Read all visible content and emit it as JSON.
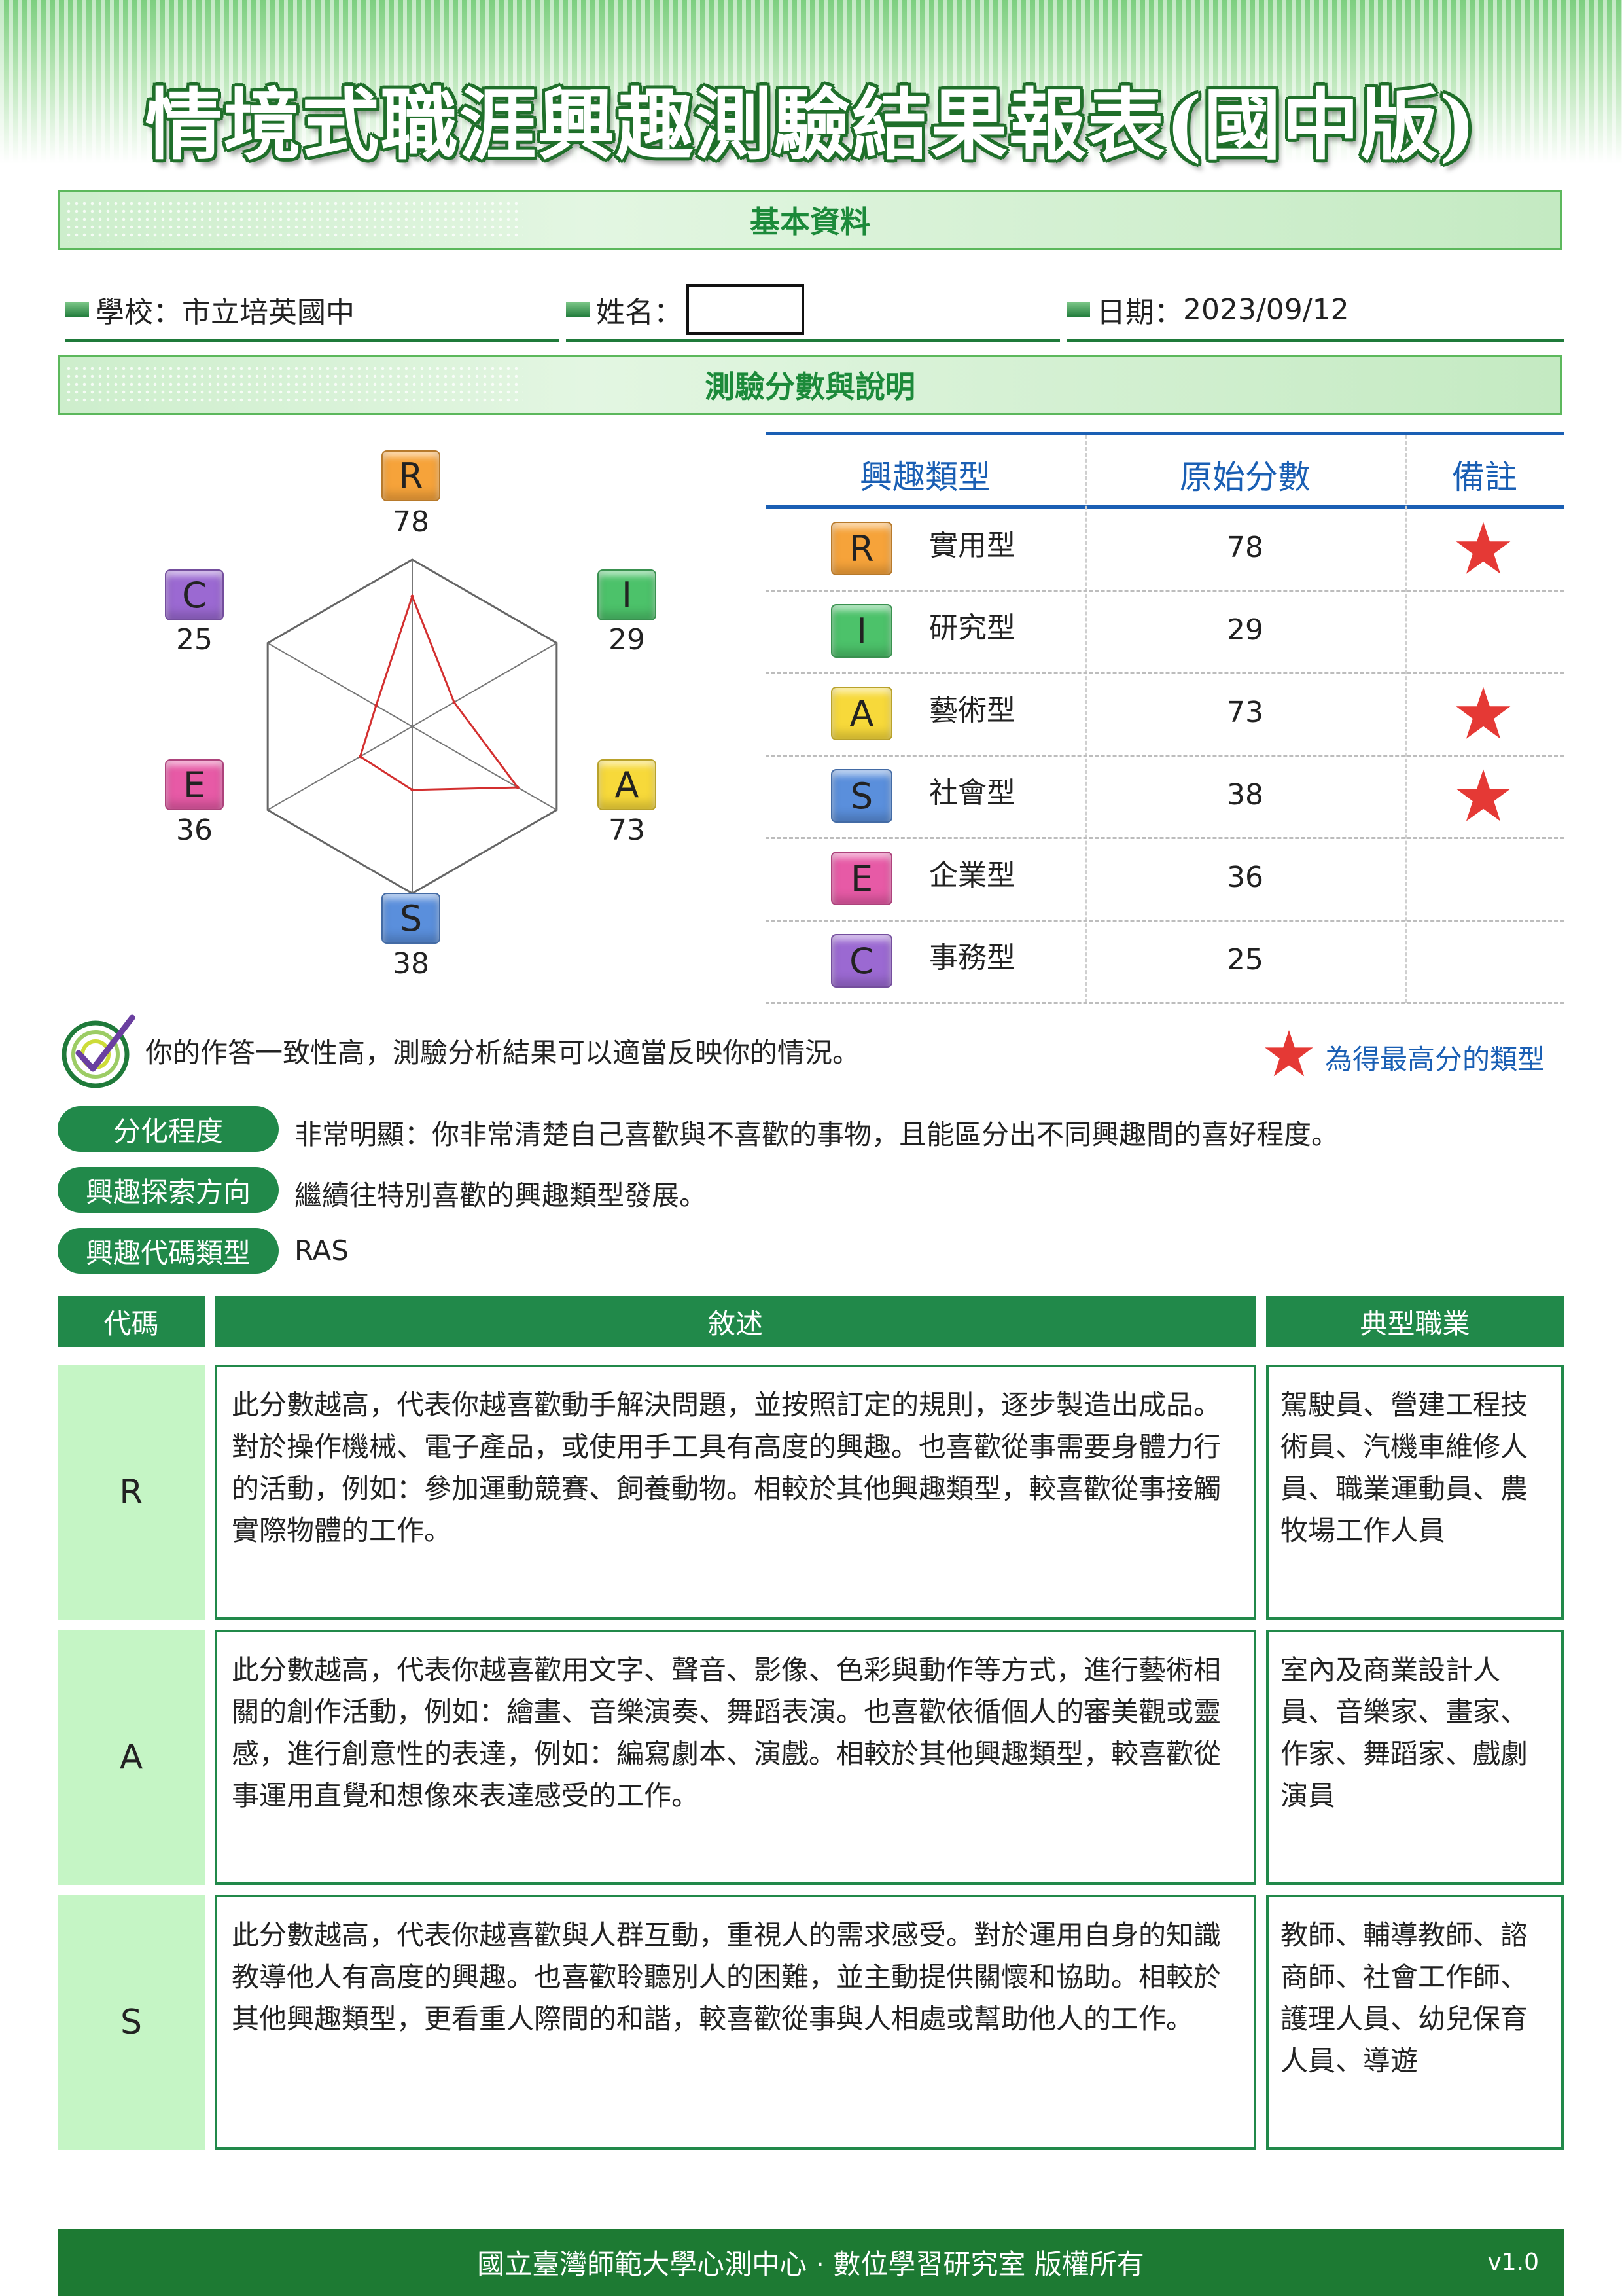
{
  "title": "情境式職涯興趣測驗結果報表(國中版)",
  "sections": {
    "basic_info": "基本資料",
    "scores": "測驗分數與說明"
  },
  "info": {
    "school_label": "學校：",
    "school_value": "市立培英國中",
    "name_label": "姓名：",
    "date_label": "日期：",
    "date_value": "2023/09/12"
  },
  "radar": {
    "labels": [
      {
        "code": "R",
        "value": "78"
      },
      {
        "code": "I",
        "value": "29"
      },
      {
        "code": "A",
        "value": "73"
      },
      {
        "code": "S",
        "value": "38"
      },
      {
        "code": "E",
        "value": "36"
      },
      {
        "code": "C",
        "value": "25"
      }
    ]
  },
  "chart_data": {
    "type": "radar",
    "categories": [
      "R",
      "I",
      "A",
      "S",
      "E",
      "C"
    ],
    "values": [
      78,
      29,
      73,
      38,
      36,
      25
    ],
    "rlim": [
      0,
      100
    ]
  },
  "score_table": {
    "headers": [
      "興趣類型",
      "原始分數",
      "備註"
    ],
    "rows": [
      {
        "code": "R",
        "name": "實用型",
        "score": "78",
        "star": true
      },
      {
        "code": "I",
        "name": "研究型",
        "score": "29",
        "star": false
      },
      {
        "code": "A",
        "name": "藝術型",
        "score": "73",
        "star": true
      },
      {
        "code": "S",
        "name": "社會型",
        "score": "38",
        "star": true
      },
      {
        "code": "E",
        "name": "企業型",
        "score": "36",
        "star": false
      },
      {
        "code": "C",
        "name": "事務型",
        "score": "25",
        "star": false
      }
    ]
  },
  "colors": {
    "R": "#f6a33a",
    "I": "#4cc26a",
    "A": "#f7d93a",
    "S": "#5a8fdc",
    "E": "#e75aa6",
    "C": "#9b69d2",
    "accent": "#21894a",
    "header_blue": "#1a5fb4",
    "star": "#e53935"
  },
  "consistency_text": "你的作答一致性高，測驗分析結果可以適當反映你的情況。",
  "legend_text": "為得最高分的類型",
  "summary": [
    {
      "label": "分化程度",
      "text": "非常明顯：你非常清楚自己喜歡與不喜歡的事物，且能區分出不同興趣間的喜好程度。"
    },
    {
      "label": "興趣探索方向",
      "text": "繼續往特別喜歡的興趣類型發展。"
    },
    {
      "label": "興趣代碼類型",
      "text": "RAS"
    }
  ],
  "desc_table": {
    "headers": [
      "代碼",
      "敘述",
      "典型職業"
    ],
    "rows": [
      {
        "code": "R",
        "desc": "此分數越高，代表你越喜歡動手解決問題，並按照訂定的規則，逐步製造出成品。對於操作機械、電子產品，或使用手工具有高度的興趣。也喜歡從事需要身體力行的活動，例如：參加運動競賽、飼養動物。相較於其他興趣類型，較喜歡從事接觸實際物體的工作。",
        "jobs": "駕駛員、營建工程技術員、汽機車維修人員、職業運動員、農牧場工作人員"
      },
      {
        "code": "A",
        "desc": "此分數越高，代表你越喜歡用文字、聲音、影像、色彩與動作等方式，進行藝術相關的創作活動，例如：繪畫、音樂演奏、舞蹈表演。也喜歡依循個人的審美觀或靈感，進行創意性的表達，例如：編寫劇本、演戲。相較於其他興趣類型，較喜歡從事運用直覺和想像來表達感受的工作。",
        "jobs": "室內及商業設計人員、音樂家、畫家、作家、舞蹈家、戲劇演員"
      },
      {
        "code": "S",
        "desc": "此分數越高，代表你越喜歡與人群互動，重視人的需求感受。對於運用自身的知識教導他人有高度的興趣。也喜歡聆聽別人的困難，並主動提供關懷和協助。相較於其他興趣類型，更看重人際間的和諧，較喜歡從事與人相處或幫助他人的工作。",
        "jobs": "教師、輔導教師、諮商師、社會工作師、護理人員、幼兒保育人員、導遊"
      }
    ]
  },
  "footer": {
    "copyright": "國立臺灣師範大學心測中心 · 數位學習研究室 版權所有",
    "version": "v1.0"
  }
}
